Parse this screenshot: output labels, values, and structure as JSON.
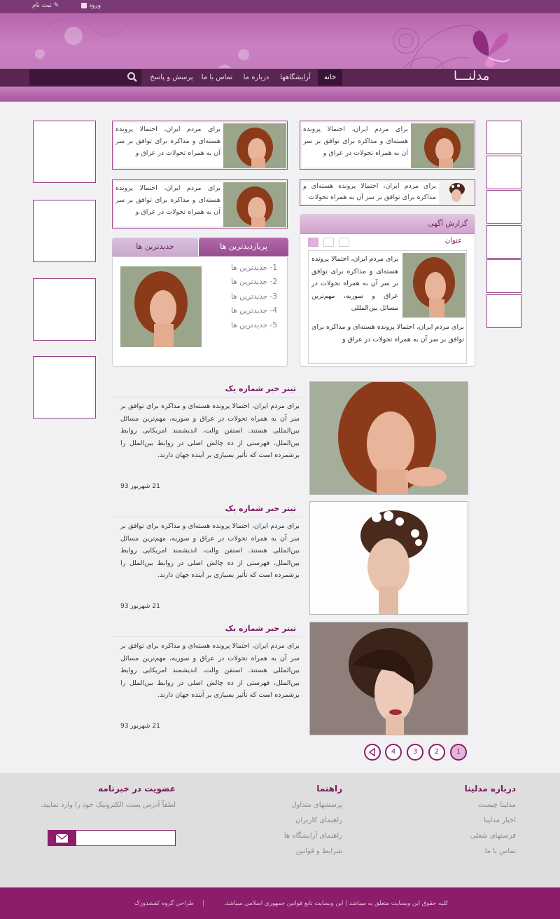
{
  "topbar": {
    "login": "ورود",
    "register": "ثبت نام"
  },
  "logo": {
    "text": "مدلنـــا"
  },
  "nav": {
    "items": [
      {
        "label": "خانه"
      },
      {
        "label": "آرایشگاهها"
      },
      {
        "label": "درباره ما"
      },
      {
        "label": "تماس با ما"
      },
      {
        "label": "پرسش و پاسخ"
      }
    ],
    "search_placeholder": ""
  },
  "mini_cards": {
    "text_long": "برای مردم ایران، احتمالا پرونده هسته‌ای و مذاکره برای توافق بر سر آن به همراه تحولات در عراق و",
    "text_short": "برای مردم ایران، احتمالا پرونده هسته‌ای و مذاکره برای توافق بر سر آن به همراه تحولات"
  },
  "ad_report": {
    "title": "گزارش آگهی",
    "heading": "عنوان",
    "text1": "برای مردم ایران، احتمالا پرونده هسته‌ای و مذاکره برای توافق بر سر آن به همراه تحولات در عراق و سوریه، مهم‌ترین مسائل بین‌المللی",
    "text2": "برای مردم ایران، احتمالا پرونده هسته‌ای و مذاکره برای توافق بر سر آن به همراه تحولات در عراق و"
  },
  "tabs_panel": {
    "tab_active": "پربازدیدترین ها",
    "tab_inactive": "جدیدترین ها",
    "items": [
      "1- جدیدترین ها",
      "2- جدیدترین ها",
      "3- جدیدترین ها",
      "4- جدیدترین ها",
      "5- جدیدترین ها"
    ]
  },
  "news": [
    {
      "title": "تیتر خبر شماره یک",
      "body": "برای مردم ایران، احتمالا پرونده هسته‌ای و مذاکره برای توافق بر سر آن به همراه تحولات در عراق و سوریه، مهم‌ترین مسائل بین‌المللی هستند. استفن والت، اندیشمند امریکایی روابط بین‌الملل، فهرستی از ده چالش اصلی در روابط بین‌الملل را برشمرده است که تأثیر بسیاری بر آینده جهان دارند.",
      "date": "21 شهریور 93"
    },
    {
      "title": "تیتر خبر شماره یک",
      "body": "برای مردم ایران، احتمالا پرونده هسته‌ای و مذاکره برای توافق بر سر آن به همراه تحولات در عراق و سوریه، مهم‌ترین مسائل بین‌المللی هستند. استفن والت، اندیشمند امریکایی روابط بین‌الملل، فهرستی از ده چالش اصلی در روابط بین‌الملل را برشمرده است که تأثیر بسیاری بر آینده جهان دارند.",
      "date": "21 شهریور 93"
    },
    {
      "title": "تیتر خبر شماره یک",
      "body": "برای مردم ایران، احتمالا پرونده هسته‌ای و مذاکره برای توافق بر سر آن به همراه تحولات در عراق و سوریه، مهم‌ترین مسائل بین‌المللی هستند. استفن والت، اندیشمند امریکایی روابط بین‌الملل، فهرستی از ده چالش اصلی در روابط بین‌الملل را برشمرده است که تأثیر بسیاری بر آینده جهان دارند.",
      "date": "21 شهریور 93"
    }
  ],
  "pagination": {
    "pages": [
      "1",
      "2",
      "3",
      "4"
    ],
    "current": "1"
  },
  "footer": {
    "about": {
      "title": "درباره مدلینا",
      "links": [
        "مدلینا چیست",
        "اخبار مدلینا",
        "فرصتهای شغلی",
        "تماس با ما"
      ]
    },
    "guide": {
      "title": "راهنما",
      "links": [
        "پرسشهای متداول",
        "راهنمای کاربران",
        "راهنمای آرایشگاه ها",
        "شرایط و قوانین"
      ]
    },
    "newsletter": {
      "title": "عضویت در خبرنامه",
      "desc": "لطفاً آدرس پست الکترونیک خود را وارد نمایید.",
      "placeholder": ""
    }
  },
  "copyright": {
    "text": "کلیه حقوق این وبسایت متعلق به میباشد | این وبسایت تابع قوانین جمهوری اسلامی میباشد.",
    "design": "طراحی گروه کفشدوزک"
  },
  "colors": {
    "brand": "#8b1d6b",
    "accent": "#a34b92",
    "nav_bg": "#5a2453"
  }
}
